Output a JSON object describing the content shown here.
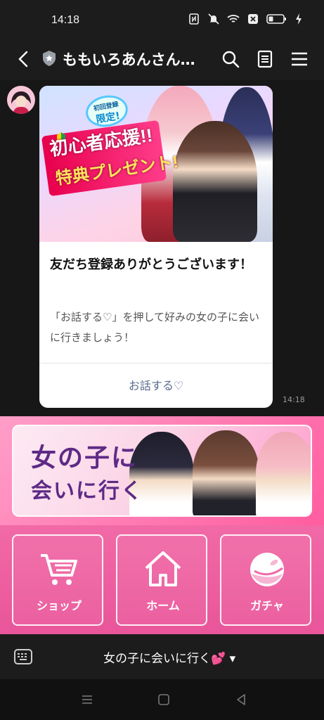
{
  "status": {
    "time": "14:18"
  },
  "header": {
    "title": "ももいろあんさん…"
  },
  "message": {
    "card_title": "友だち登録ありがとうございます！",
    "card_body": "「お話する♡」を押して好みの女の子に会いに行きましょう！",
    "card_action": "お話する♡",
    "time": "14:18",
    "image": {
      "badge_top": "初回登録",
      "badge_main": "限定!",
      "line1": "初心者応援!!",
      "line2": "特典プレゼント!"
    }
  },
  "richmenu": {
    "banner_line1": "女の子に",
    "banner_line2": "会いに行く",
    "buttons": [
      {
        "label": "ショップ",
        "icon": "cart-icon"
      },
      {
        "label": "ホーム",
        "icon": "home-icon"
      },
      {
        "label": "ガチャ",
        "icon": "gacha-icon"
      }
    ]
  },
  "bottom": {
    "menu_label": "女の子に会いに行く💕 ▾"
  }
}
